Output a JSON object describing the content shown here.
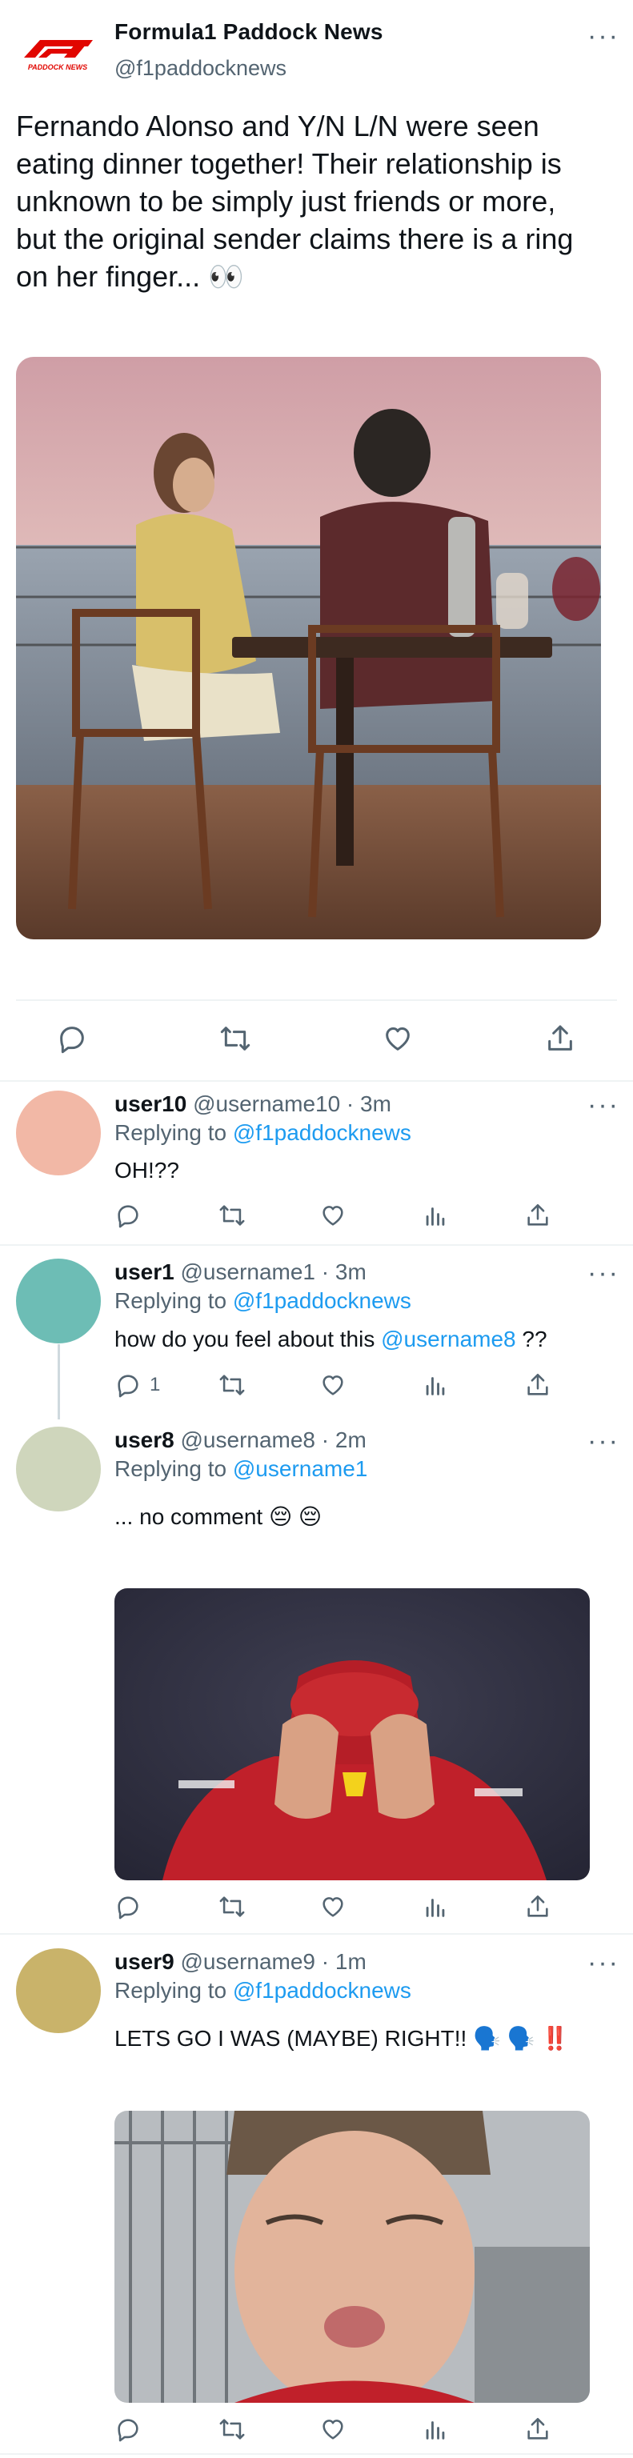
{
  "main": {
    "name": "Formula1 Paddock News",
    "handle": "@f1paddocknews",
    "logo_text": "PADDOCK NEWS",
    "text": "Fernando Alonso and Y/N L/N were seen\neating dinner together! Their relationship is\nunknown to be simply just friends or more,\nbut the original sender claims there is a ring\non her finger... 👀",
    "more": "···"
  },
  "replies": [
    {
      "name": "user10",
      "meta": "@username10 · 3m",
      "replying_prefix": "Replying to",
      "replying_to": "@f1paddocknews",
      "text": "OH!??",
      "avatar_color": "#f2b8a6",
      "reply_count": ""
    },
    {
      "name": "user1",
      "meta": "@username1 · 3m",
      "replying_prefix": "Replying to",
      "replying_to": "@f1paddocknews",
      "text_before": "how do you feel about this",
      "mention": "@username8",
      "text_after": "??",
      "avatar_color": "#6dbdb5",
      "reply_count": "1"
    },
    {
      "name": "user8",
      "meta": "@username8 · 2m",
      "replying_prefix": "Replying to",
      "replying_to": "@username1",
      "text": "... no comment 😔 😔",
      "avatar_color": "#cfd6bc",
      "reply_count": ""
    },
    {
      "name": "user9",
      "meta": "@username9 · 1m",
      "replying_prefix": "Replying to",
      "replying_to": "@f1paddocknews",
      "text": "LETS GO I WAS (MAYBE) RIGHT!! 🗣️ 🗣️ ‼️",
      "avatar_color": "#c9b36a",
      "reply_count": ""
    }
  ],
  "colors": {
    "accent": "#1d9bf0",
    "muted": "#536471",
    "brand_red": "#e10600"
  },
  "icons": {
    "reply": "reply-icon",
    "retweet": "retweet-icon",
    "like": "like-icon",
    "analytics": "analytics-icon",
    "share": "share-icon",
    "more": "more-icon"
  }
}
